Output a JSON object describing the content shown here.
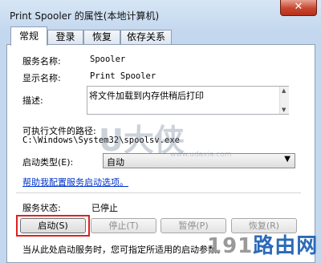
{
  "window": {
    "title": "Print Spooler 的属性(本地计算机)",
    "close_glyph": "✕"
  },
  "tabs": [
    {
      "label": "常规",
      "active": true
    },
    {
      "label": "登录",
      "active": false
    },
    {
      "label": "恢复",
      "active": false
    },
    {
      "label": "依存关系",
      "active": false
    }
  ],
  "general": {
    "service_name_label": "服务名称:",
    "service_name_value": "Spooler",
    "display_name_label": "显示名称:",
    "display_name_value": "Print Spooler",
    "description_label": "描述:",
    "description_value": "将文件加载到内存供稍后打印",
    "path_label": "可执行文件的路径:",
    "path_value": "C:\\Windows\\System32\\spoolsv.exe",
    "startup_type_label": "启动类型(E):",
    "startup_type_value": "自动",
    "help_link": "帮助我配置服务启动选项。",
    "status_label": "服务状态:",
    "status_value": "已停止",
    "hint_text": "当从此处启动服务时，您可指定所适用的启动参数。"
  },
  "buttons": {
    "start": "启动(S)",
    "stop": "停止(T)",
    "pause": "暂停(P)",
    "resume": "恢复(R)"
  },
  "watermark": {
    "brand": "U大侠",
    "url": "www.udaxia.com",
    "logo_digits": "191",
    "logo_text": "路由网"
  },
  "colors": {
    "highlight_border": "#e02020",
    "link": "#0033cc",
    "logo_digits": "#9a9a9a",
    "logo_text": "#2a6ab8"
  }
}
